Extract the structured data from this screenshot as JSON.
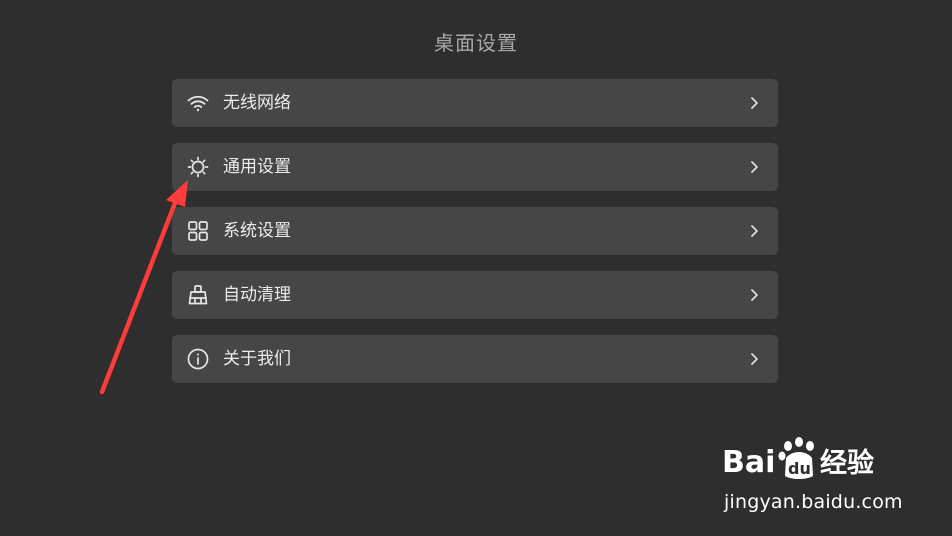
{
  "header": {
    "title": "桌面设置"
  },
  "menu": {
    "items": [
      {
        "label": "无线网络",
        "icon": "wifi-icon"
      },
      {
        "label": "通用设置",
        "icon": "sun-gear-icon"
      },
      {
        "label": "系统设置",
        "icon": "grid-icon"
      },
      {
        "label": "自动清理",
        "icon": "broom-icon"
      },
      {
        "label": "关于我们",
        "icon": "info-icon"
      }
    ]
  },
  "annotation": {
    "arrow_color": "#ff3b3b",
    "points_to": "通用设置"
  },
  "watermark": {
    "logo_text": "Baidu经验",
    "url": "jingyan.baidu.com"
  },
  "colors": {
    "background": "#2e2e2e",
    "item_background": "#464646",
    "title_text": "#a8a8a8",
    "item_text": "#ececec"
  }
}
